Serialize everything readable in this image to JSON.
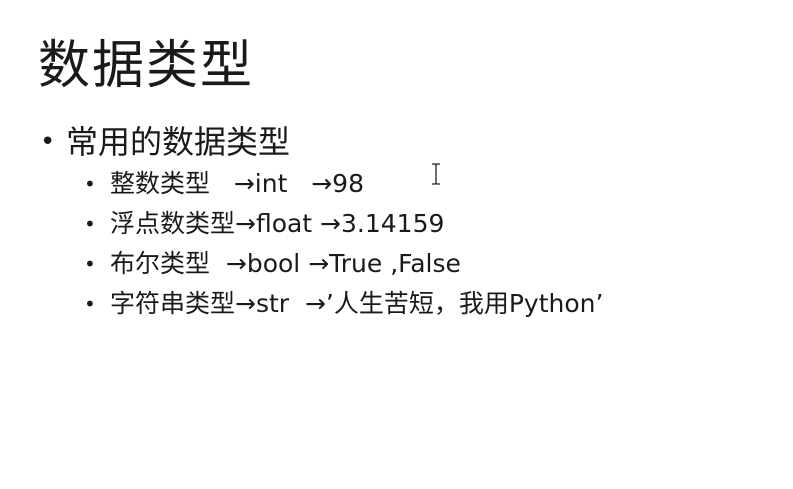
{
  "slide": {
    "title": "数据类型",
    "main_bullet": "常用的数据类型",
    "items": [
      {
        "text": "整数类型   →int   →98"
      },
      {
        "text": "浮点数类型→float →3.14159"
      },
      {
        "text": "布尔类型  →bool →True ,False"
      },
      {
        "text": "字符串类型→str  →’人生苦短，我用Python’"
      }
    ]
  },
  "icons": {
    "cursor": "text-cursor-icon"
  }
}
